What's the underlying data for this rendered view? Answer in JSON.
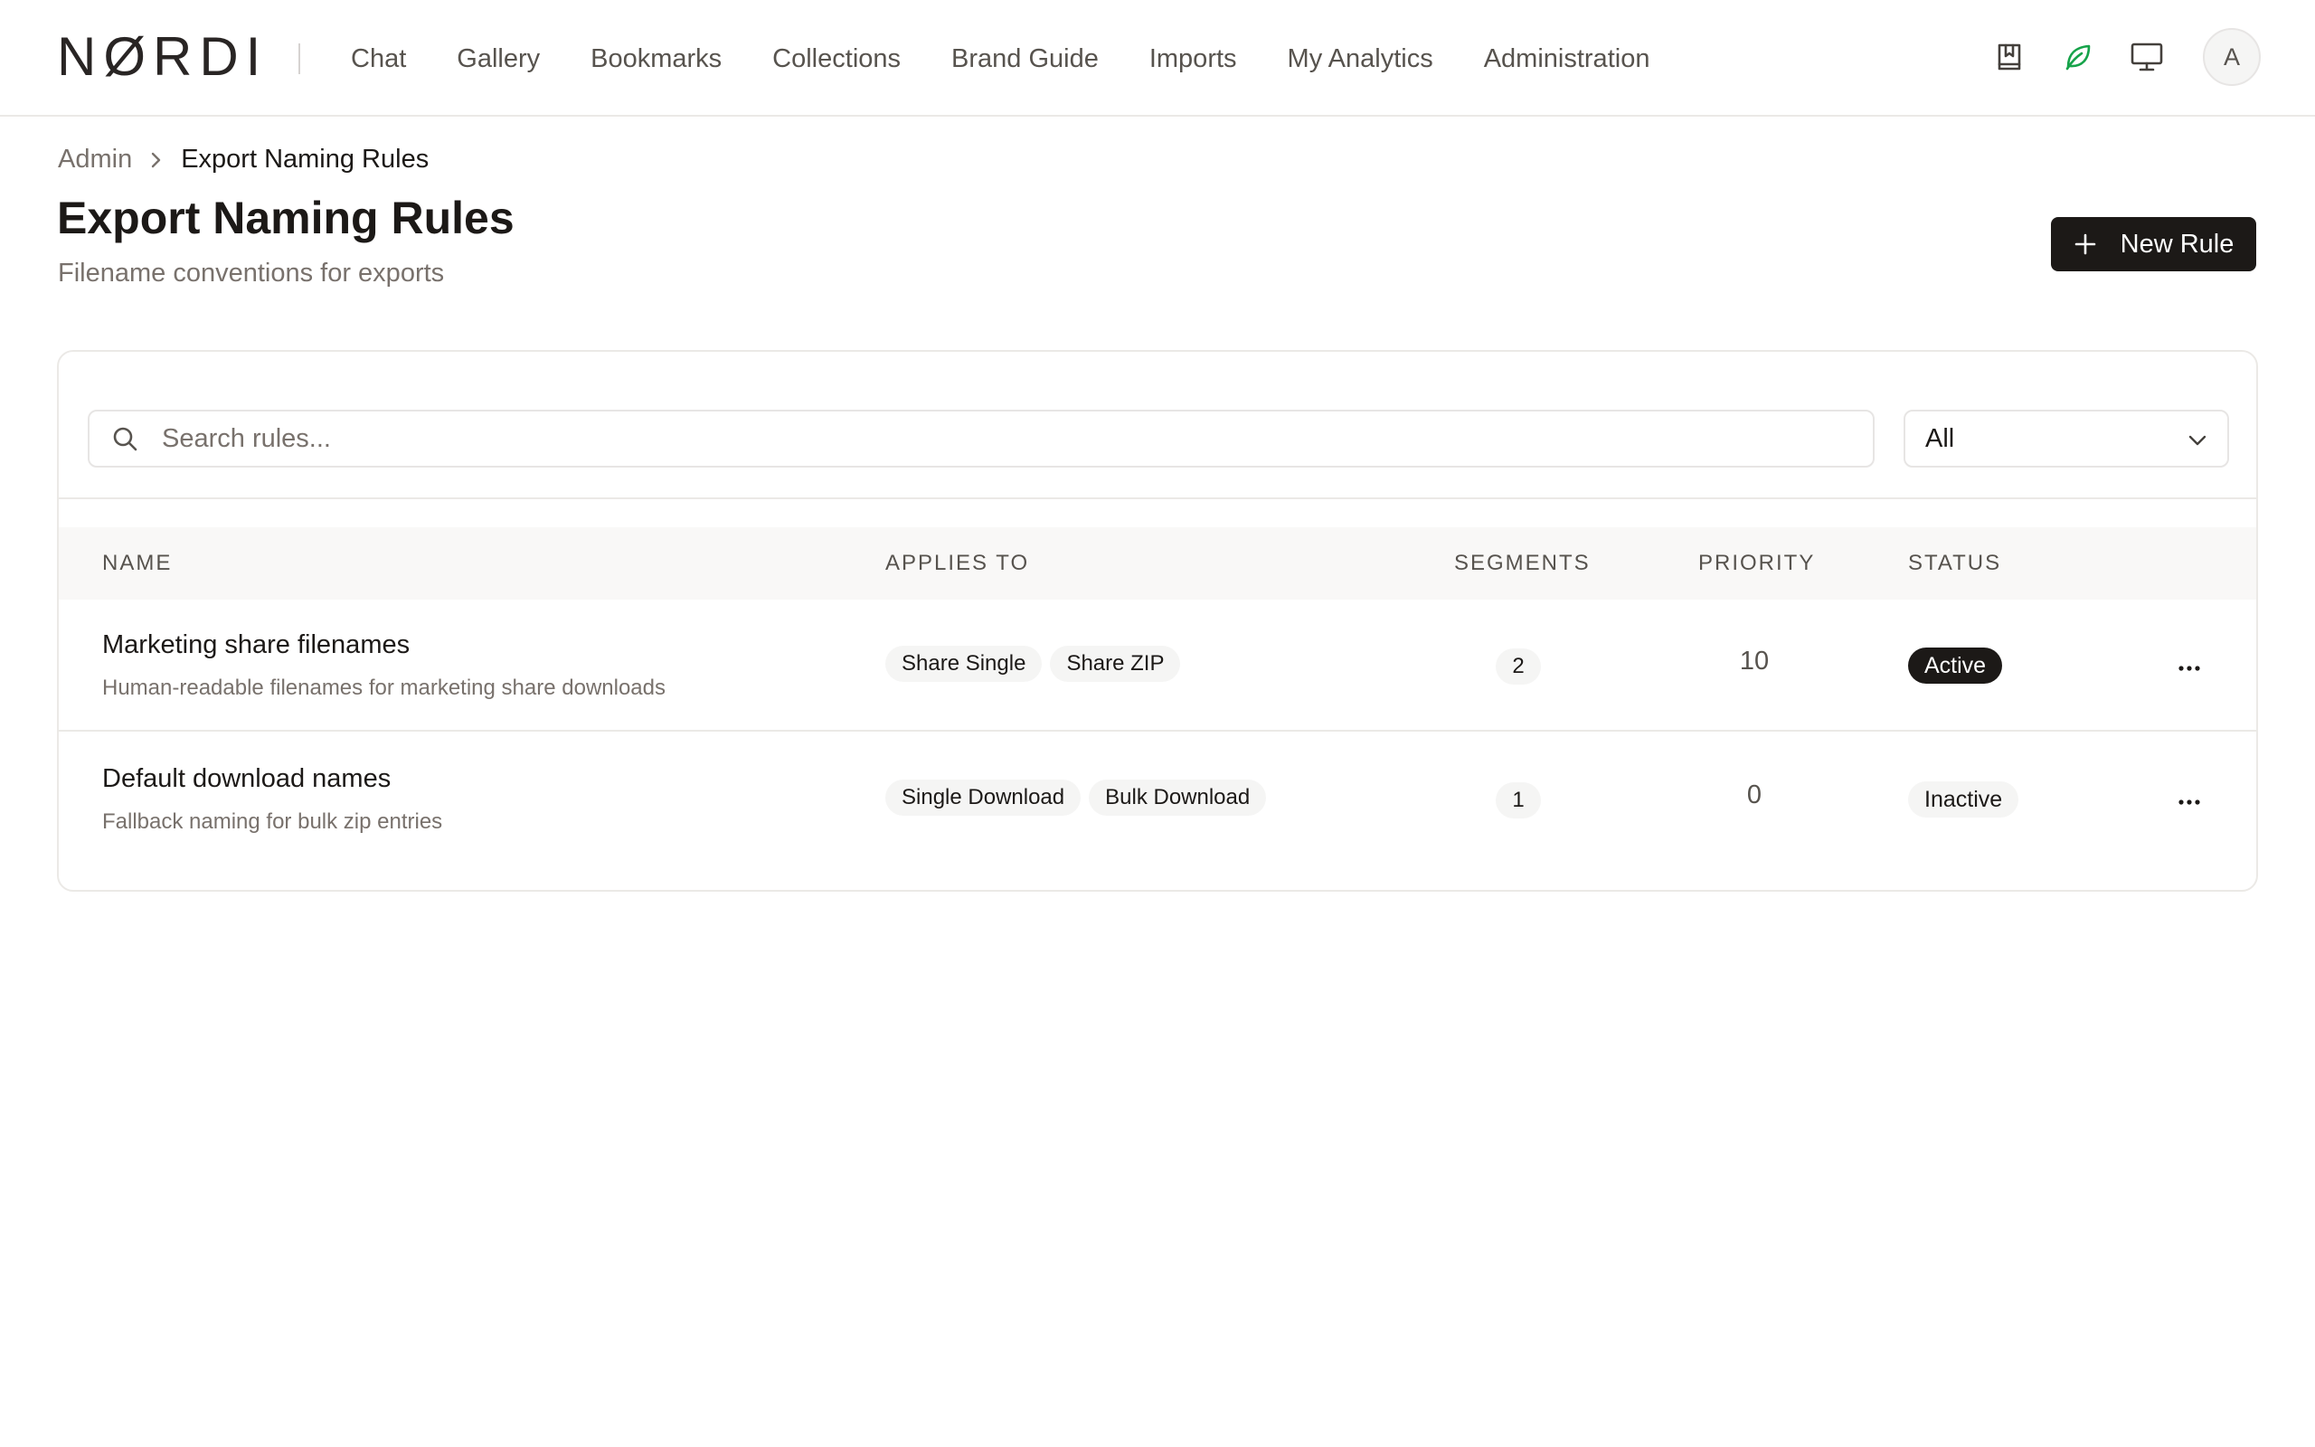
{
  "brand": {
    "logo_text": "NØRDI"
  },
  "nav": {
    "items": [
      "Chat",
      "Gallery",
      "Bookmarks",
      "Collections",
      "Brand Guide",
      "Imports",
      "My Analytics",
      "Administration"
    ]
  },
  "top_icons": {
    "icons": [
      "book-bookmark-icon",
      "leaf-icon",
      "monitor-icon"
    ],
    "leaf_color": "#16a34a",
    "avatar_initial": "A"
  },
  "breadcrumb": {
    "parent": "Admin",
    "current": "Export Naming Rules"
  },
  "header": {
    "title": "Export Naming Rules",
    "subtitle": "Filename conventions for exports",
    "new_button_label": "New Rule"
  },
  "filters": {
    "search_placeholder": "Search rules...",
    "status_filter_value": "All"
  },
  "table": {
    "columns": [
      "NAME",
      "APPLIES TO",
      "SEGMENTS",
      "PRIORITY",
      "STATUS"
    ],
    "rows": [
      {
        "name": "Marketing share filenames",
        "description": "Human-readable filenames for marketing share downloads",
        "applies_to": [
          "Share Single",
          "Share ZIP"
        ],
        "segments": "2",
        "priority": "10",
        "status": "Active"
      },
      {
        "name": "Default download names",
        "description": "Fallback naming for bulk zip entries",
        "applies_to": [
          "Single Download",
          "Bulk Download"
        ],
        "segments": "1",
        "priority": "0",
        "status": "Inactive"
      }
    ]
  },
  "colors": {
    "primary_dark": "#1c1917",
    "muted_text": "#78716c",
    "border": "#ebe9e6"
  }
}
